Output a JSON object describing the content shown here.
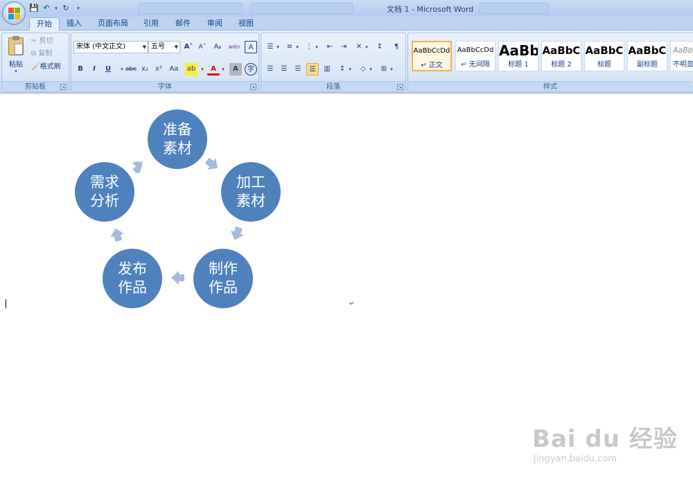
{
  "window": {
    "title": "文档 1 - Microsoft Word"
  },
  "tabs": [
    {
      "label": "开始",
      "active": true
    },
    {
      "label": "插入"
    },
    {
      "label": "页面布局"
    },
    {
      "label": "引用"
    },
    {
      "label": "邮件"
    },
    {
      "label": "审阅"
    },
    {
      "label": "视图"
    }
  ],
  "clipboard": {
    "paste": "粘贴",
    "cut": "剪切",
    "copy": "复制",
    "format_painter": "格式刷",
    "group_label": "剪贴板"
  },
  "font": {
    "font_name": "宋体 (中文正文)",
    "font_size": "五号",
    "group_label": "字体",
    "buttons": {
      "grow": "A˄",
      "shrink": "A˅",
      "clear": "Aᵦ",
      "phonetic": "wén",
      "border": "A",
      "bold": "B",
      "italic": "I",
      "underline": "U",
      "strike": "abc",
      "sub": "x₂",
      "sup": "x²",
      "case": "Aa",
      "highlight": "ab",
      "color": "A",
      "shade": "A",
      "enclose": "字"
    }
  },
  "paragraph": {
    "group_label": "段落"
  },
  "styles": {
    "group_label": "样式",
    "items": [
      {
        "sample": "AaBbCcDd",
        "name": "↵ 正文",
        "selected": true
      },
      {
        "sample": "AaBbCcDd",
        "name": "↵ 无间隔"
      },
      {
        "sample": "AaBb",
        "name": "标题 1"
      },
      {
        "sample": "AaBbC",
        "name": "标题 2"
      },
      {
        "sample": "AaBbC",
        "name": "标题"
      },
      {
        "sample": "AaBbC",
        "name": "副标题"
      },
      {
        "sample": "AaBbC",
        "name": "不明显"
      }
    ]
  },
  "diagram": {
    "color": "#4f81bd",
    "arrow_color": "#a6bad9",
    "nodes": [
      {
        "line1": "准备",
        "line2": "素材"
      },
      {
        "line1": "加工",
        "line2": "素材"
      },
      {
        "line1": "制作",
        "line2": "作品"
      },
      {
        "line1": "发布",
        "line2": "作品"
      },
      {
        "line1": "需求",
        "line2": "分析"
      }
    ]
  },
  "document": {
    "paragraph_mark": "↵"
  },
  "watermark": {
    "logo": "Bai du 经验",
    "url": "jingyan.baidu.com"
  }
}
